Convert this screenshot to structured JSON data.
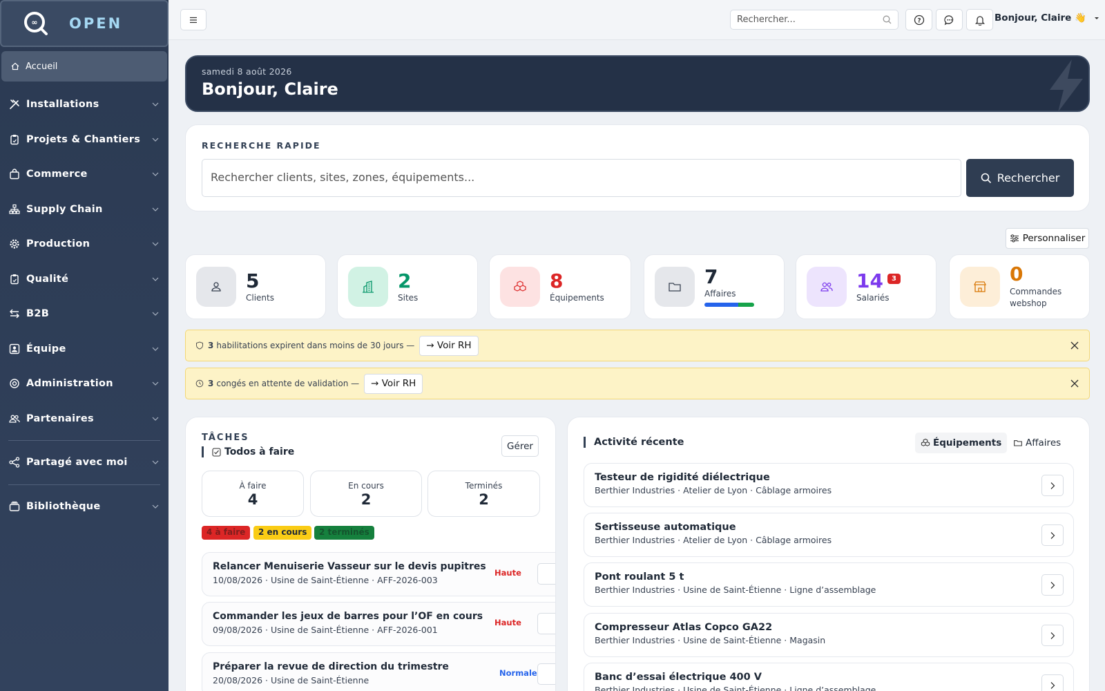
{
  "brand": {
    "name": "OPEN"
  },
  "sidebar": {
    "home": "Accueil",
    "items": [
      {
        "label": "Installations",
        "icon": "tools-icon"
      },
      {
        "label": "Projets & Chantiers",
        "icon": "clipboard-icon"
      },
      {
        "label": "Commerce",
        "icon": "bag-icon"
      },
      {
        "label": "Supply Chain",
        "icon": "network-icon"
      },
      {
        "label": "Production",
        "icon": "gear-icon"
      },
      {
        "label": "Qualité",
        "icon": "clipboard-check-icon"
      },
      {
        "label": "B2B",
        "icon": "arrows-icon"
      },
      {
        "label": "Équipe",
        "icon": "person-badge-icon"
      },
      {
        "label": "Administration",
        "icon": "cog-icon"
      },
      {
        "label": "Partenaires",
        "icon": "people-icon"
      }
    ],
    "shared": "Partagé avec moi",
    "library": "Bibliothèque"
  },
  "topbar": {
    "search_placeholder": "Rechercher...",
    "greeting": "Bonjour, Claire 👋"
  },
  "hero": {
    "date": "samedi 8 août 2026",
    "title": "Bonjour, Claire"
  },
  "quick_search": {
    "label": "RECHERCHE RAPIDE",
    "placeholder": "Rechercher clients, sites, zones, équipements...",
    "button": "Rechercher"
  },
  "customize": "Personnaliser",
  "stats": [
    {
      "value": "5",
      "label": "Clients",
      "color": "#1f2937",
      "bg": "#e5e7eb"
    },
    {
      "value": "2",
      "label": "Sites",
      "color": "#059669",
      "bg": "#d1f2e4"
    },
    {
      "value": "8",
      "label": "Équipements",
      "color": "#dc2626",
      "bg": "#fde2e2"
    },
    {
      "value": "7",
      "label": "Affaires",
      "color": "#1f2937",
      "bg": "#e5e7eb"
    },
    {
      "value": "14",
      "label": "Salariés",
      "badge": "3",
      "color": "#7c3aed",
      "bg": "#ede4fd"
    },
    {
      "value": "0",
      "label": "Commandes webshop",
      "color": "#d97706",
      "bg": "#fdeed8"
    }
  ],
  "alerts": [
    {
      "count": "3",
      "text": "habilitations expirent dans moins de 30 jours —",
      "button": "→ Voir RH"
    },
    {
      "count": "3",
      "text": "congés en attente de validation —",
      "button": "→ Voir RH"
    }
  ],
  "tasks": {
    "label": "TÂCHES",
    "subtitle": "Todos à faire",
    "manage": "Gérer",
    "counters": [
      {
        "label": "À faire",
        "value": "4"
      },
      {
        "label": "En cours",
        "value": "2"
      },
      {
        "label": "Terminés",
        "value": "2"
      }
    ],
    "pills": [
      "4 à faire",
      "2 en cours",
      "2 terminés"
    ],
    "rows": [
      {
        "title": "Relancer Menuiserie Vasseur sur le devis pupitres",
        "meta": "10/08/2026 · Usine de Saint-Étienne · AFF-2026-003",
        "priority": "Haute"
      },
      {
        "title": "Commander les jeux de barres pour l’OF en cours",
        "meta": "09/08/2026 · Usine de Saint-Étienne · AFF-2026-001",
        "priority": "Haute"
      },
      {
        "title": "Préparer la revue de direction du trimestre",
        "meta": "20/08/2026 · Usine de Saint-Étienne",
        "priority": "Normale"
      }
    ]
  },
  "activity": {
    "title": "Activité récente",
    "tabs": [
      "Équipements",
      "Affaires"
    ],
    "rows": [
      {
        "title": "Testeur de rigidité diélectrique",
        "meta": "Berthier Industries · Atelier de Lyon · Câblage armoires"
      },
      {
        "title": "Sertisseuse automatique",
        "meta": "Berthier Industries · Atelier de Lyon · Câblage armoires"
      },
      {
        "title": "Pont roulant 5 t",
        "meta": "Berthier Industries · Usine de Saint-Étienne · Ligne d’assemblage"
      },
      {
        "title": "Compresseur Atlas Copco GA22",
        "meta": "Berthier Industries · Usine de Saint-Étienne · Magasin"
      },
      {
        "title": "Banc d’essai électrique 400 V",
        "meta": "Berthier Industries · Usine de Saint-Étienne · Ligne d’assemblage"
      }
    ]
  }
}
